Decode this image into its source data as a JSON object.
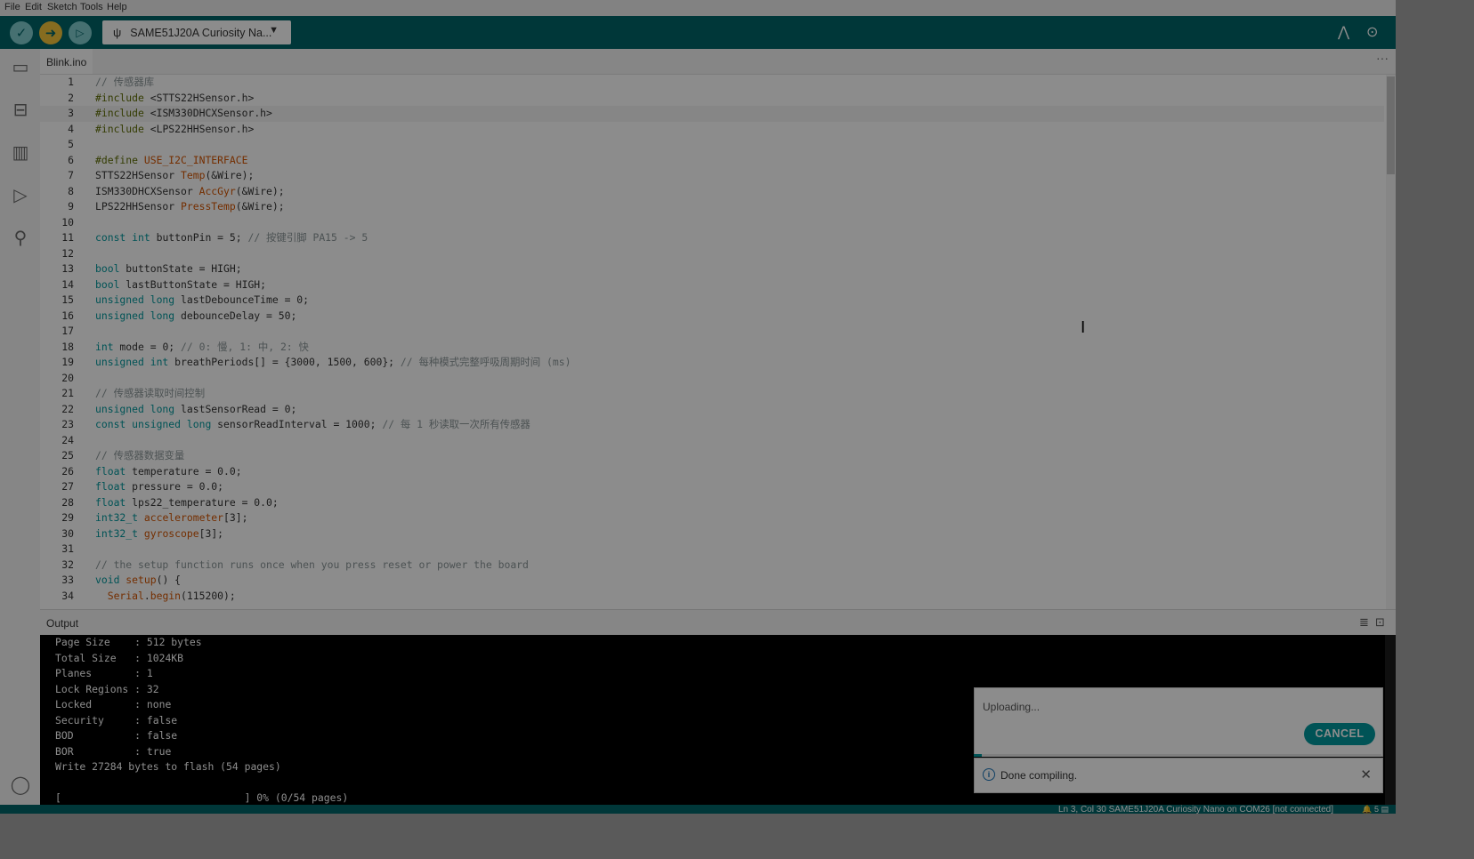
{
  "menu": [
    "File",
    "Edit",
    "Sketch",
    "Tools",
    "Help"
  ],
  "toolbar": {
    "verify_icon": "checkmark-icon",
    "upload_icon": "arrow-right-icon",
    "debug_icon": "debug-icon",
    "board": "SAME51J20A Curiosity Na...",
    "serial_plotter_icon": "serial-plotter-icon",
    "serial_monitor_icon": "serial-monitor-icon"
  },
  "sidebar_icons": [
    "sketchbook-icon",
    "boards-manager-icon",
    "library-manager-icon",
    "debug-icon",
    "search-icon",
    "account-icon"
  ],
  "tab": {
    "name": "Blink.ino",
    "more": "···"
  },
  "editor": {
    "current_line": 3,
    "lines": [
      [
        [
          "comment",
          "// 传感器库"
        ]
      ],
      [
        [
          "preproc",
          "#include "
        ],
        [
          "plain",
          "<STTS22HSensor.h>"
        ]
      ],
      [
        [
          "preproc",
          "#include "
        ],
        [
          "plain",
          "<ISM330DHCXSensor.h>"
        ]
      ],
      [
        [
          "preproc",
          "#include "
        ],
        [
          "plain",
          "<LPS22HHSensor.h>"
        ]
      ],
      [],
      [
        [
          "preproc",
          "#define "
        ],
        [
          "func",
          "USE_I2C_INTERFACE"
        ]
      ],
      [
        [
          "plain",
          "STTS22HSensor "
        ],
        [
          "func",
          "Temp"
        ],
        [
          "plain",
          "(&Wire);"
        ]
      ],
      [
        [
          "plain",
          "ISM330DHCXSensor "
        ],
        [
          "func",
          "AccGyr"
        ],
        [
          "plain",
          "(&Wire);"
        ]
      ],
      [
        [
          "plain",
          "LPS22HHSensor "
        ],
        [
          "func",
          "PressTemp"
        ],
        [
          "plain",
          "(&Wire);"
        ]
      ],
      [],
      [
        [
          "keyword",
          "const int"
        ],
        [
          "plain",
          " buttonPin = 5; "
        ],
        [
          "comment",
          "// 按键引脚 PA15 -> 5"
        ]
      ],
      [],
      [
        [
          "keyword",
          "bool"
        ],
        [
          "plain",
          " buttonState = HIGH;"
        ]
      ],
      [
        [
          "keyword",
          "bool"
        ],
        [
          "plain",
          " lastButtonState = HIGH;"
        ]
      ],
      [
        [
          "keyword",
          "unsigned long"
        ],
        [
          "plain",
          " lastDebounceTime = 0;"
        ]
      ],
      [
        [
          "keyword",
          "unsigned long"
        ],
        [
          "plain",
          " debounceDelay = 50;"
        ]
      ],
      [],
      [
        [
          "keyword",
          "int"
        ],
        [
          "plain",
          " mode = 0; "
        ],
        [
          "comment",
          "// 0: 慢, 1: 中, 2: 快"
        ]
      ],
      [
        [
          "keyword",
          "unsigned int"
        ],
        [
          "plain",
          " breathPeriods[] = {3000, 1500, 600}; "
        ],
        [
          "comment",
          "// 每种模式完整呼吸周期时间 (ms)"
        ]
      ],
      [],
      [
        [
          "comment",
          "// 传感器读取时间控制"
        ]
      ],
      [
        [
          "keyword",
          "unsigned long"
        ],
        [
          "plain",
          " lastSensorRead = 0;"
        ]
      ],
      [
        [
          "keyword",
          "const unsigned long"
        ],
        [
          "plain",
          " sensorReadInterval = 1000; "
        ],
        [
          "comment",
          "// 每 1 秒读取一次所有传感器"
        ]
      ],
      [],
      [
        [
          "comment",
          "// 传感器数据变量"
        ]
      ],
      [
        [
          "keyword",
          "float"
        ],
        [
          "plain",
          " temperature = 0.0;"
        ]
      ],
      [
        [
          "keyword",
          "float"
        ],
        [
          "plain",
          " pressure = 0.0;"
        ]
      ],
      [
        [
          "keyword",
          "float"
        ],
        [
          "plain",
          " lps22_temperature = 0.0;"
        ]
      ],
      [
        [
          "keyword",
          "int32_t"
        ],
        [
          "plain",
          " "
        ],
        [
          "func",
          "accelerometer"
        ],
        [
          "plain",
          "[3];"
        ]
      ],
      [
        [
          "keyword",
          "int32_t"
        ],
        [
          "plain",
          " "
        ],
        [
          "func",
          "gyroscope"
        ],
        [
          "plain",
          "[3];"
        ]
      ],
      [],
      [
        [
          "comment",
          "// the setup function runs once when you press reset or power the board"
        ]
      ],
      [
        [
          "keyword",
          "void"
        ],
        [
          "plain",
          " "
        ],
        [
          "func",
          "setup"
        ],
        [
          "plain",
          "() {"
        ]
      ],
      [
        [
          "plain",
          "  "
        ],
        [
          "func",
          "Serial"
        ],
        [
          "plain",
          "."
        ],
        [
          "func",
          "begin"
        ],
        [
          "plain",
          "(115200);"
        ]
      ]
    ]
  },
  "output": {
    "title": "Output",
    "clear_icon": "clear-output-icon",
    "lock_icon": "lock-icon",
    "lines": [
      "Page Size    : 512 bytes",
      "Total Size   : 1024KB",
      "Planes       : 1",
      "Lock Regions : 32",
      "Locked       : none",
      "Security     : false",
      "BOD          : false",
      "BOR          : true",
      "Write 27284 bytes to flash (54 pages)",
      "",
      "[                              ] 0% (0/54 pages)"
    ]
  },
  "notifications": {
    "uploading": "Uploading...",
    "cancel": "CANCEL",
    "progress": 0.02,
    "done": "Done compiling.",
    "info_icon": "info-icon",
    "close_icon": "close-icon"
  },
  "status": {
    "text": "Ln 3, Col 30   SAME51J20A Curiosity Nano on COM26 [not connected]",
    "icons": "🔔 5  ▤"
  },
  "colors": {
    "toolbar": "#006468",
    "accent": "#00979c",
    "upload_button": "#f3c43a",
    "verify_button": "#7fcbcd"
  }
}
